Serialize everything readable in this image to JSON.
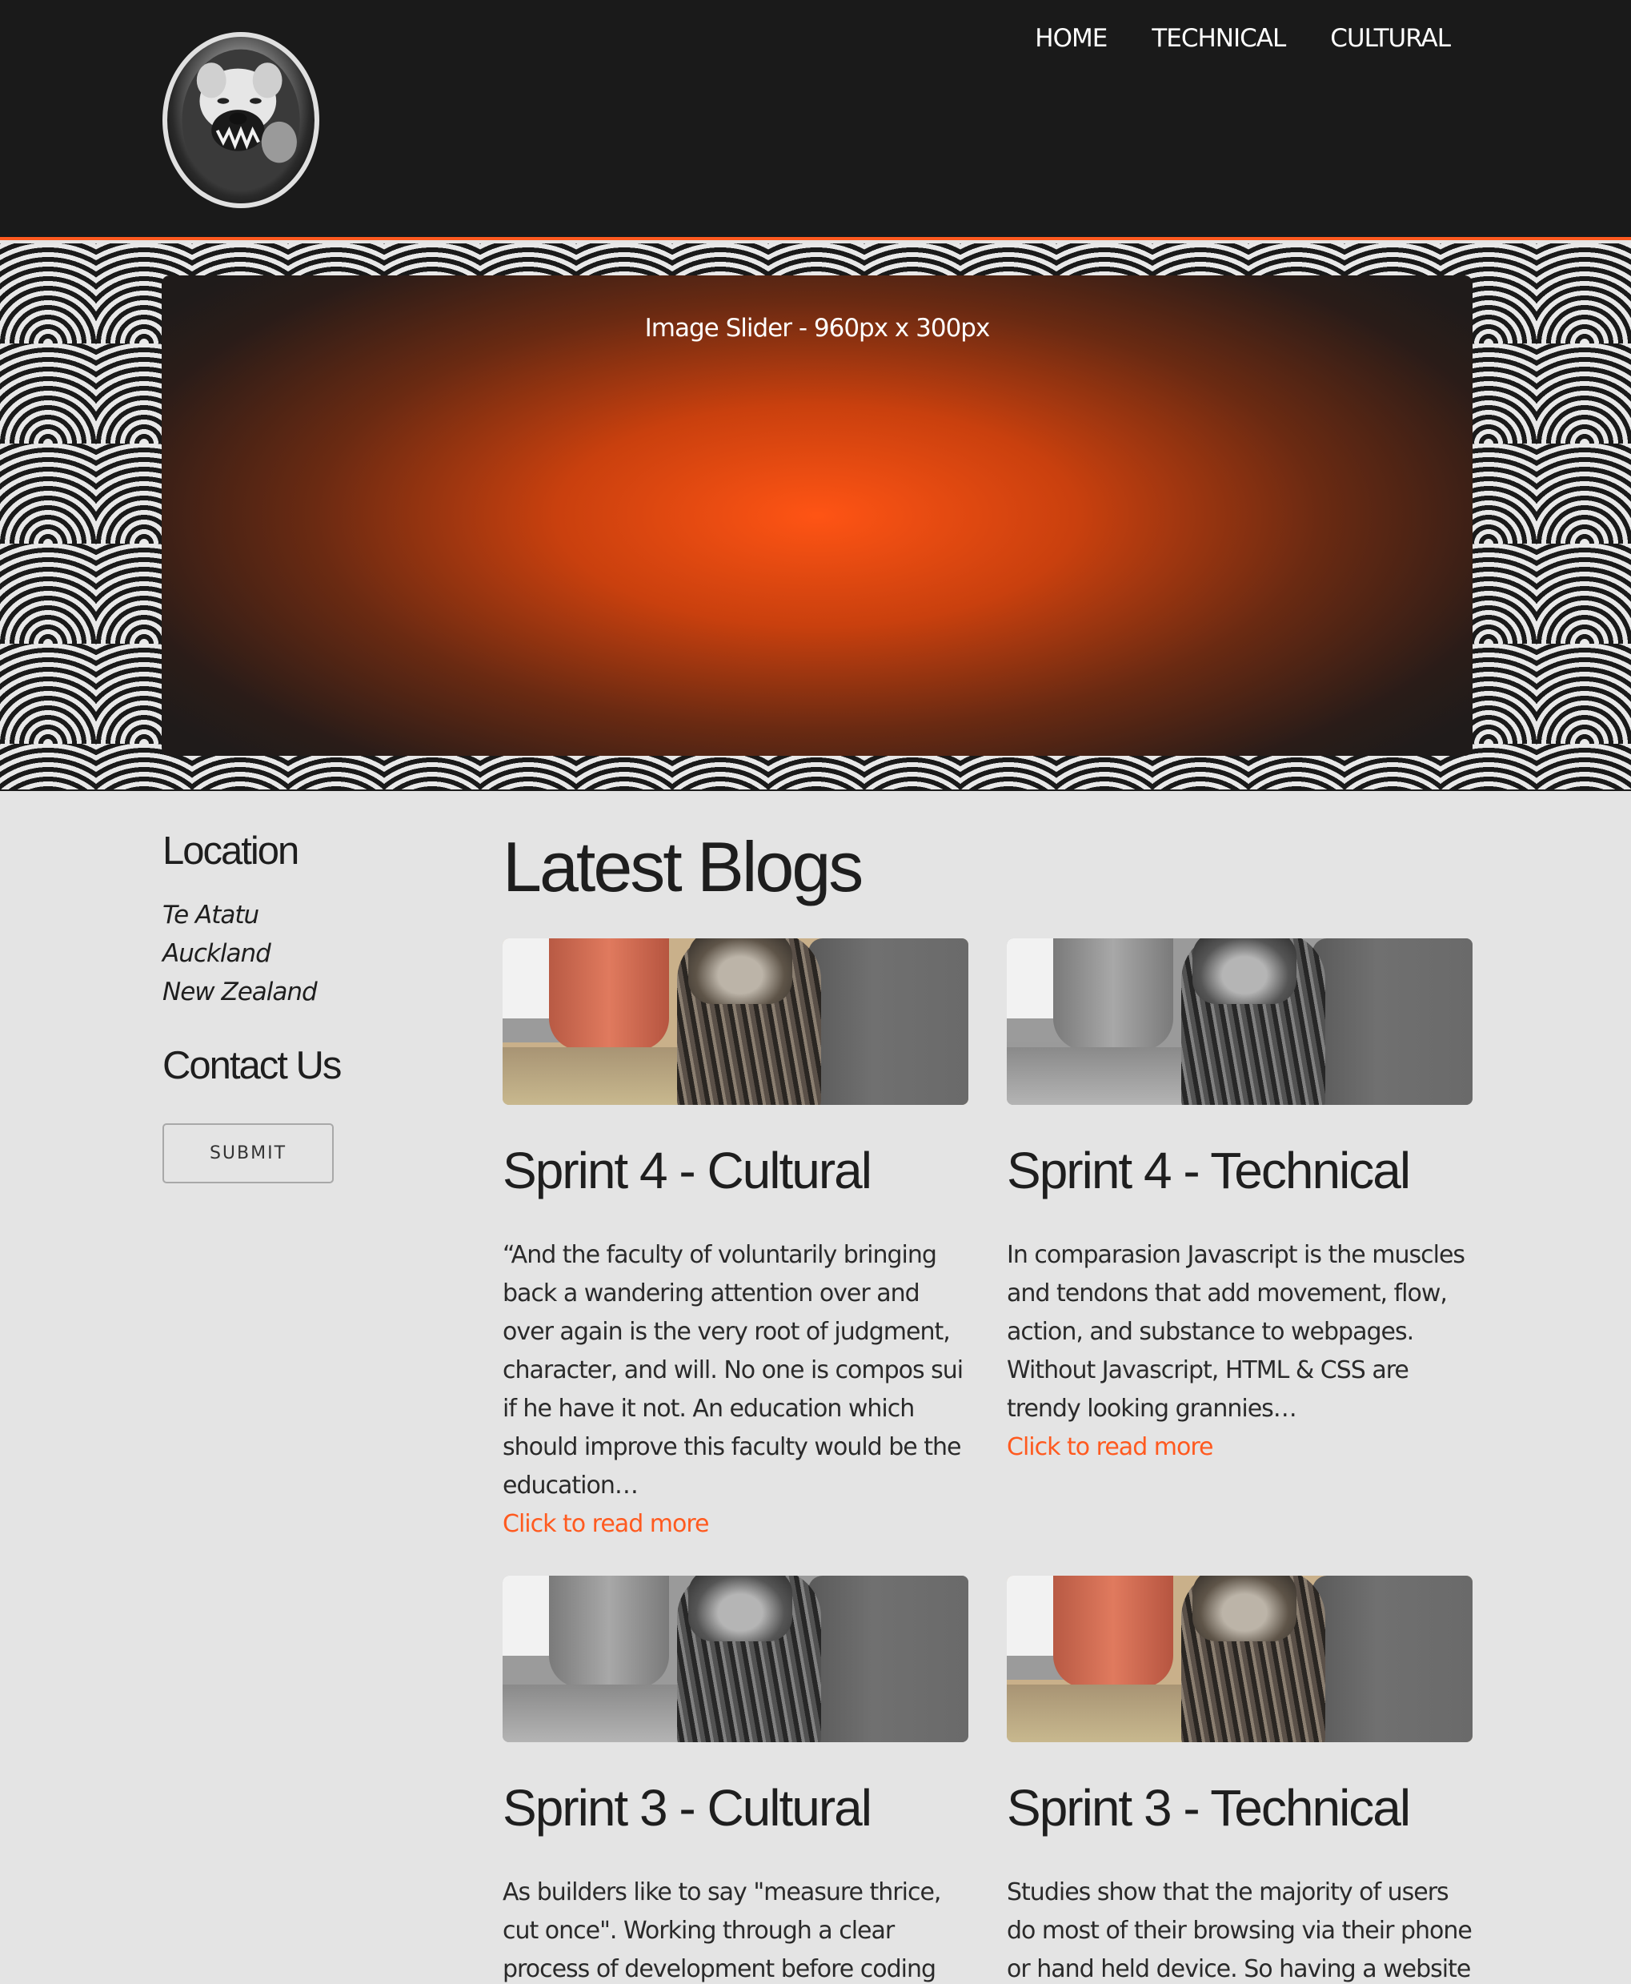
{
  "nav": {
    "items": [
      "HOME",
      "TECHNICAL",
      "CULTURAL"
    ]
  },
  "slider": {
    "caption": "Image Slider - 960px x 300px"
  },
  "sidebar": {
    "location_heading": "Location",
    "address": [
      "Te Atatu",
      "Auckland",
      "New Zealand"
    ],
    "contact_heading": "Contact Us",
    "submit_label": "SUBMIT"
  },
  "blogs": {
    "title": "Latest Blogs",
    "read_more": "Click to read more",
    "posts": [
      {
        "title": "Sprint 4 - Cultural",
        "excerpt": "“And the faculty of voluntarily bringing back a wandering attention over and over again is the very root of judgment, character, and will. No one is compos sui if he have it not. An education which should improve this faculty would be the education…",
        "image_style": "color"
      },
      {
        "title": "Sprint 4 - Technical",
        "excerpt": "In comparasion Javascript is the muscles and tendons that add movement, flow, action, and substance to webpages. Without Javascript, HTML & CSS are trendy looking grannies…",
        "image_style": "grayscale"
      },
      {
        "title": "Sprint 3 - Cultural",
        "excerpt": "As builders like to say \"measure thrice, cut once\". Working through a clear process of development before coding even begins allows the developer to thing through their",
        "image_style": "grayscale"
      },
      {
        "title": "Sprint 3 - Technical",
        "excerpt": "Studies show that the majority of users do most of their browsing via their phone or hand held device. So having a website that looks good and is easily navigated",
        "image_style": "color"
      }
    ]
  },
  "colors": {
    "accent": "#ff5a1f",
    "header_bg": "#1a1a1a",
    "page_bg": "#e4e4e4"
  }
}
